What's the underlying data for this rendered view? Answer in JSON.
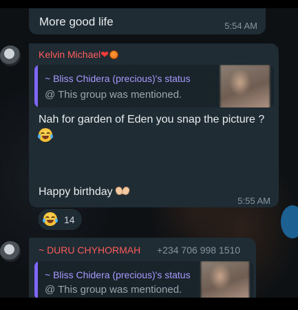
{
  "messages": {
    "prev": {
      "text": "More good life",
      "time": "5:54 AM"
    },
    "kelvin": {
      "sender": "Kelvin Michael",
      "sender_emojis": [
        "red-heart",
        "basketball"
      ],
      "quote": {
        "title": "~ Bliss Chidera (precious)'s status",
        "mention": "@ This group was mentioned."
      },
      "text": "Nah for garden of Eden you snap the picture ?",
      "emoji": "face-with-tears-of-joy",
      "text2": "Happy birthday",
      "text2_emoji": "heart-hands",
      "time": "5:55 AM",
      "reaction": {
        "emoji": "face-with-tears-of-joy",
        "count": "14"
      }
    },
    "duru": {
      "sender": "~ DURU CHYHORMAH",
      "phone": "+234 706 998 1510",
      "quote": {
        "title": "~ Bliss Chidera (precious)'s status",
        "mention": "@ This group was mentioned."
      }
    }
  },
  "colors": {
    "bubble": "#1f2c34",
    "quote_bar": "#7f66ff",
    "sender": "#ff5c5c",
    "timestamp": "#8696a0"
  }
}
